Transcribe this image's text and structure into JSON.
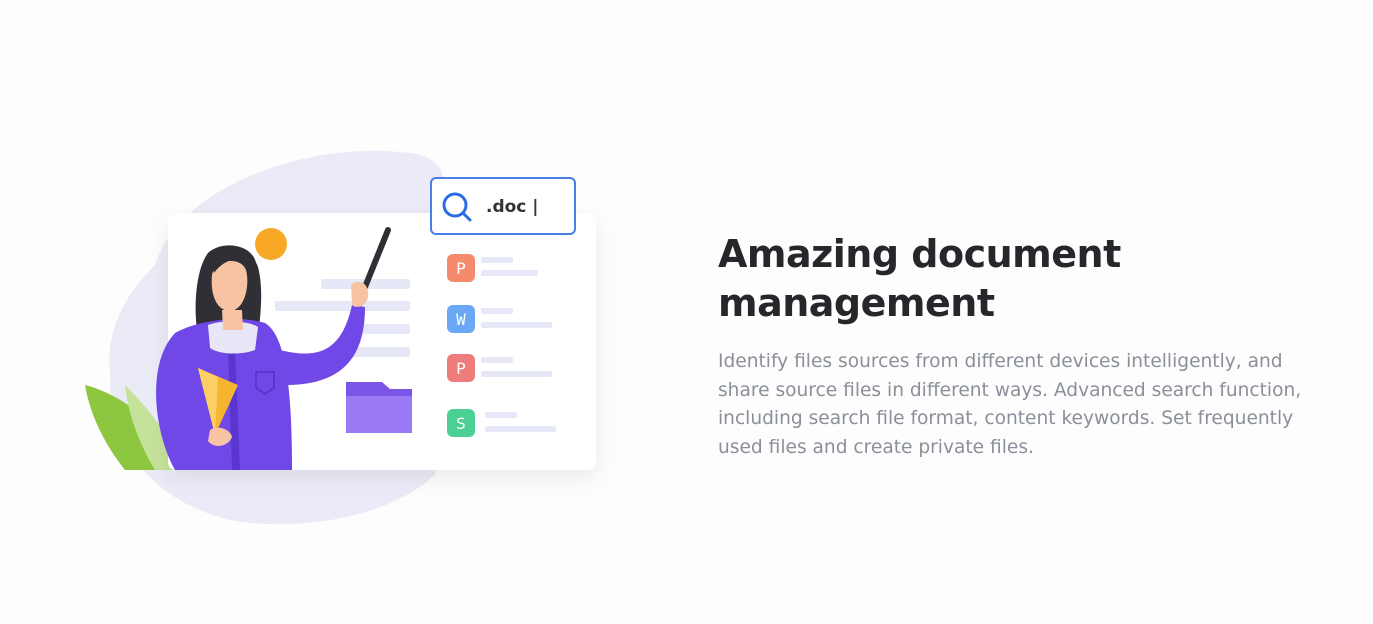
{
  "feature": {
    "title": "Amazing document management",
    "description": "Identify files sources from different devices intelligently, and share source files in different ways. Advanced search function, including search file format, content keywords. Set frequently used files and create private files."
  },
  "illustration": {
    "search_query": ".doc |",
    "file_types": [
      {
        "icon": "pdf-icon",
        "letter": "P",
        "color": "#f58b6c"
      },
      {
        "icon": "word-icon",
        "letter": "W",
        "color": "#6aa8f5"
      },
      {
        "icon": "ppt-icon",
        "letter": "P",
        "color": "#ef7b7b"
      },
      {
        "icon": "spreadsheet-icon",
        "letter": "S",
        "color": "#4ccf94"
      }
    ],
    "colors": {
      "accent": "#7048e8",
      "search_border": "#4a7ee8",
      "blob": "#ebebf7",
      "sun": "#f9a825",
      "leaf": "#8dc63f"
    }
  }
}
